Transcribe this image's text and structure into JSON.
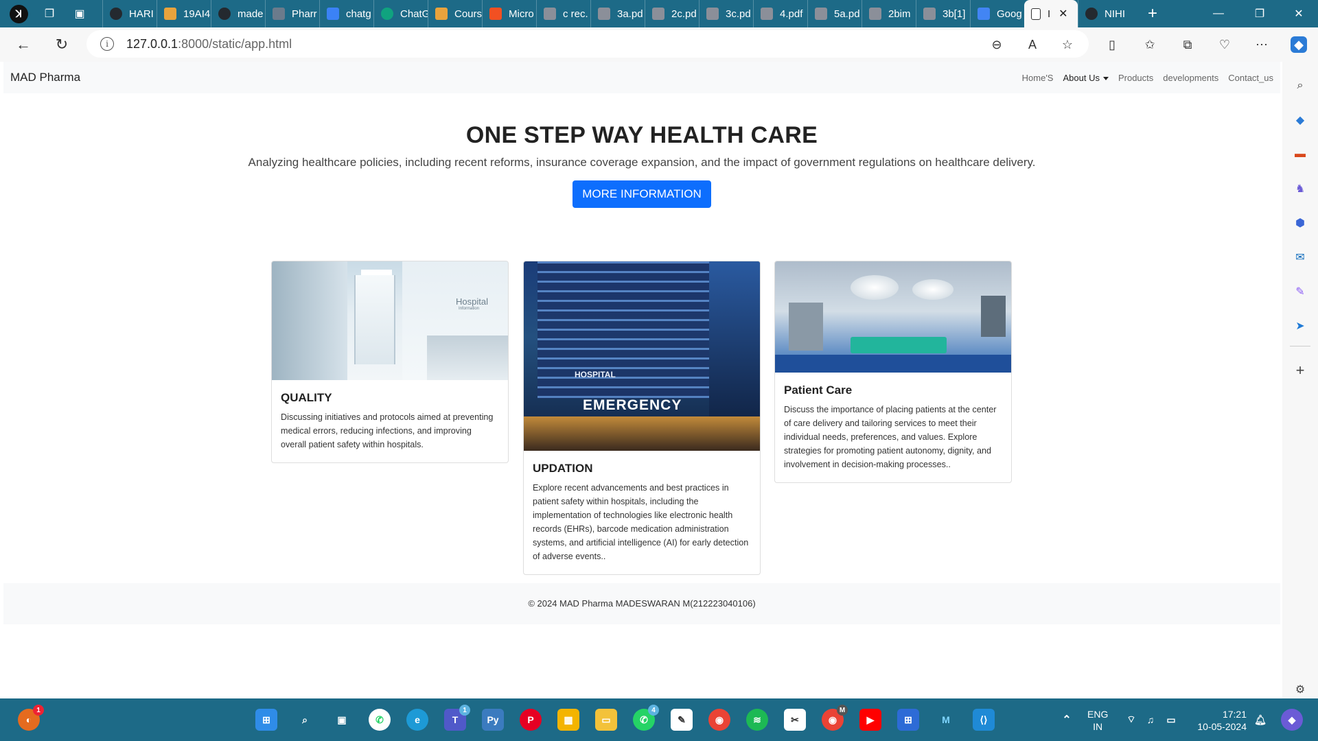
{
  "browser": {
    "tabs": [
      {
        "label": "HARI",
        "icon": "github-icon",
        "color": "#24292f"
      },
      {
        "label": "19AI4",
        "icon": "course-icon",
        "color": "#e8a33d"
      },
      {
        "label": "made",
        "icon": "github-icon",
        "color": "#24292f"
      },
      {
        "label": "Pharr",
        "icon": "page-icon",
        "color": "#6b7b8c"
      },
      {
        "label": "chatg",
        "icon": "search-icon",
        "color": "#3b82f6"
      },
      {
        "label": "ChatG",
        "icon": "chatgpt-icon",
        "color": "#10a37f"
      },
      {
        "label": "Cours",
        "icon": "course-icon",
        "color": "#e8a33d"
      },
      {
        "label": "Micro",
        "icon": "microsoft-icon",
        "color": "#f25022"
      },
      {
        "label": "c rec.",
        "icon": "pdf-icon",
        "color": "#8b8f99"
      },
      {
        "label": "3a.pd",
        "icon": "pdf-icon",
        "color": "#8b8f99"
      },
      {
        "label": "2c.pd",
        "icon": "pdf-icon",
        "color": "#8b8f99"
      },
      {
        "label": "3c.pd",
        "icon": "pdf-icon",
        "color": "#8b8f99"
      },
      {
        "label": "4.pdf",
        "icon": "pdf-icon",
        "color": "#8b8f99"
      },
      {
        "label": "5a.pd",
        "icon": "pdf-icon",
        "color": "#8b8f99"
      },
      {
        "label": "2bim",
        "icon": "pdf-icon",
        "color": "#8b8f99"
      },
      {
        "label": "3b[1]",
        "icon": "pdf-icon",
        "color": "#8b8f99"
      },
      {
        "label": "Goog",
        "icon": "google-icon",
        "color": "#4285f4"
      }
    ],
    "active_tab": {
      "label": "I"
    },
    "after_tab": {
      "label": "NIHI",
      "icon": "github-icon",
      "color": "#24292f"
    },
    "url_host": "127.0.0.1",
    "url_rest": ":8000/static/app.html"
  },
  "site": {
    "brand": "MAD Pharma",
    "nav": {
      "home": "Home'S",
      "about": "About Us",
      "products": "Products",
      "developments": "developments",
      "contact": "Contact_us"
    },
    "hero": {
      "title": "ONE STEP WAY HEALTH CARE",
      "subtitle": "Analyzing healthcare policies, including recent reforms, insurance coverage expansion, and the impact of government regulations on healthcare delivery.",
      "button": "MORE INFORMATION"
    },
    "cards": [
      {
        "title": "QUALITY",
        "text": "Discussing initiatives and protocols aimed at preventing medical errors, reducing infections, and improving overall patient safety within hospitals.",
        "image_sign": "Hospital",
        "image_sub": "Information"
      },
      {
        "title": "UPDATION",
        "text": "Explore recent advancements and best practices in patient safety within hospitals, including the implementation of technologies like electronic health records (EHRs), barcode medication administration systems, and artificial intelligence (AI) for early detection of adverse events..",
        "image_sign": "EMERGENCY",
        "image_sub": "HOSPITAL"
      },
      {
        "title": "Patient Care",
        "text": "Discuss the importance of placing patients at the center of care delivery and tailoring services to meet their individual needs, preferences, and values. Explore strategies for promoting patient autonomy, dignity, and involvement in decision-making processes.."
      }
    ],
    "footer": "© 2024 MAD Pharma MADESWARAN M(212223040106)"
  },
  "taskbar": {
    "lang_top": "ENG",
    "lang_bottom": "IN",
    "time": "17:21",
    "date": "10-05-2024",
    "badges": {
      "browser": "1",
      "teams": "1",
      "whatsapp": "4",
      "chrome": "M"
    }
  }
}
